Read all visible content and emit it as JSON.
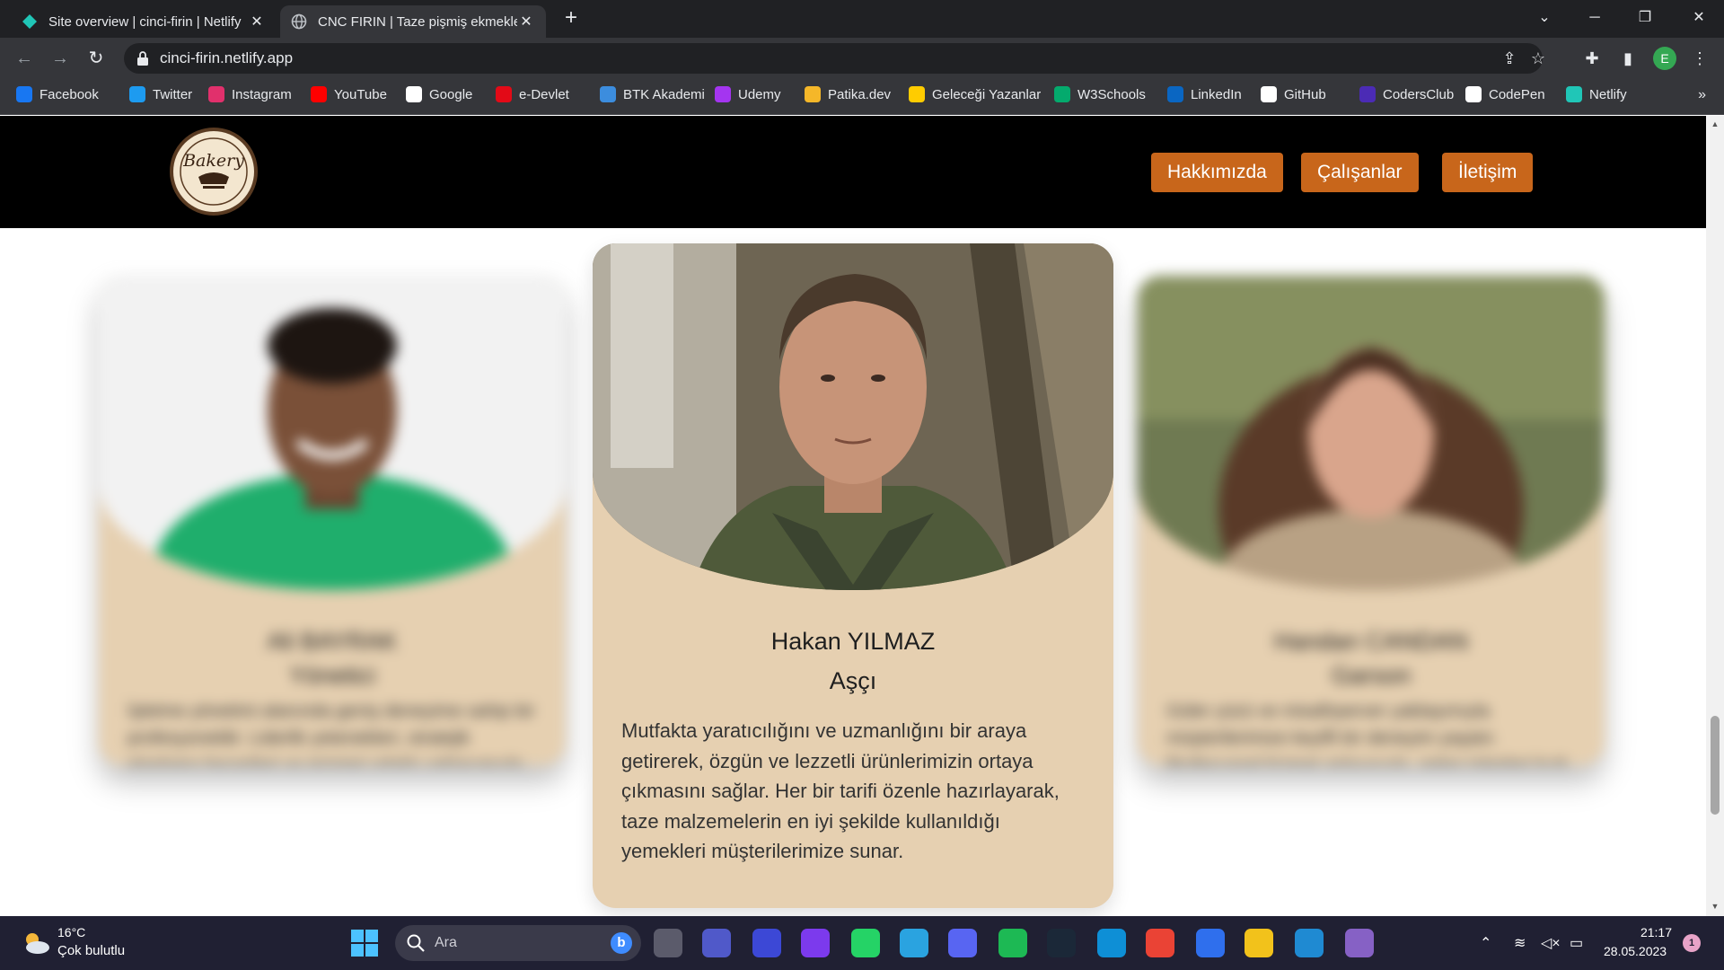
{
  "browser": {
    "tabs": [
      {
        "title": "Site overview | cinci-firin | Netlify",
        "active": false
      },
      {
        "title": "CNC FIRIN | Taze pişmiş ekmekler",
        "active": true
      }
    ],
    "url": "cinci-firin.netlify.app",
    "profile_initial": "E",
    "bookmarks": [
      {
        "label": "Facebook",
        "icon": "facebook-icon",
        "color": "#1877f2"
      },
      {
        "label": "Twitter",
        "icon": "twitter-icon",
        "color": "#1d9bf0"
      },
      {
        "label": "Instagram",
        "icon": "instagram-icon",
        "color": "#e1306c"
      },
      {
        "label": "YouTube",
        "icon": "youtube-icon",
        "color": "#ff0000"
      },
      {
        "label": "Google",
        "icon": "google-icon",
        "color": "#ffffff"
      },
      {
        "label": "e-Devlet",
        "icon": "edevlet-icon",
        "color": "#e30a17"
      },
      {
        "label": "BTK Akademi",
        "icon": "btk-icon",
        "color": "#3c8dde"
      },
      {
        "label": "Udemy",
        "icon": "udemy-icon",
        "color": "#a435f0"
      },
      {
        "label": "Patika.dev",
        "icon": "patika-icon",
        "color": "#f5b729"
      },
      {
        "label": "Geleceği Yazanlar",
        "icon": "gelecegi-yazanlar-icon",
        "color": "#ffcc00"
      },
      {
        "label": "W3Schools",
        "icon": "w3schools-icon",
        "color": "#04aa6d"
      },
      {
        "label": "LinkedIn",
        "icon": "linkedin-icon",
        "color": "#0a66c2"
      },
      {
        "label": "GitHub",
        "icon": "github-icon",
        "color": "#ffffff"
      },
      {
        "label": "CodersClub",
        "icon": "codersclub-icon",
        "color": "#4b2bb5"
      },
      {
        "label": "CodePen",
        "icon": "codepen-icon",
        "color": "#ffffff"
      },
      {
        "label": "Netlify",
        "icon": "netlify-icon",
        "color": "#20c6b7"
      }
    ],
    "more": "»"
  },
  "site": {
    "logo_text": "Bakery",
    "nav": [
      "Hakkımızda",
      "Çalışanlar",
      "İletişim"
    ],
    "accent": "#c8661b",
    "card_bg": "#e6d0b1",
    "employees": [
      {
        "name": "Ali BAYRAK",
        "role": "Yönetici",
        "desc": "İşletme yönetimi alanında geniş deneyime sahip bir profesyoneldir. Liderlik yetenekleri, stratejik planlama becerileri ve müşteri odaklı yaklaşımıyla fırının başarılı yönetimini sağlamaktadır.",
        "blurred": true
      },
      {
        "name": "Hakan YILMAZ",
        "role": "Aşçı",
        "desc": "Mutfakta yaratıcılığını ve uzmanlığını bir araya getirerek, özgün ve lezzetli ürünlerimizin ortaya çıkmasını sağlar. Her bir tarifi özenle hazırlayarak, taze malzemelerin en iyi şekilde kullanıldığı yemekleri müşterilerimize sunar.",
        "blurred": false
      },
      {
        "name": "Handan CANDAN",
        "role": "Garson",
        "desc": "Güler yüzü ve misafirperver yaklaşımıyla müşterilerimize keyifli bir deneyim yaşatır. Profesyonel hizmet anlayışıyla, gelen talepleri hızlı ve özenle karşılar.",
        "blurred": true
      }
    ]
  },
  "taskbar": {
    "weather_temp": "16°C",
    "weather_desc": "Çok bulutlu",
    "search_placeholder": "Ara",
    "apps": [
      {
        "name": "task-view-icon",
        "color": "#5b5b6b"
      },
      {
        "name": "teams-chat-icon",
        "color": "#5059c9"
      },
      {
        "name": "notes-app-icon",
        "color": "#3c48d6"
      },
      {
        "name": "clipchamp-icon",
        "color": "#7c3aed"
      },
      {
        "name": "whatsapp-icon",
        "color": "#25d366"
      },
      {
        "name": "telegram-icon",
        "color": "#2aa3e0"
      },
      {
        "name": "discord-icon",
        "color": "#5865f2"
      },
      {
        "name": "spotify-icon",
        "color": "#1db954"
      },
      {
        "name": "steam-icon",
        "color": "#1b2838"
      },
      {
        "name": "edge-icon",
        "color": "#0e8fd6"
      },
      {
        "name": "chrome-icon",
        "color": "#ea4335"
      },
      {
        "name": "notion-n-icon",
        "color": "#2f6fed"
      },
      {
        "name": "sticky-tools-icon",
        "color": "#f2c21b"
      },
      {
        "name": "vscode-icon",
        "color": "#1f8ad2"
      },
      {
        "name": "visual-studio-icon",
        "color": "#8661c5"
      }
    ],
    "time": "21:17",
    "date": "28.05.2023",
    "notification_count": "1"
  }
}
